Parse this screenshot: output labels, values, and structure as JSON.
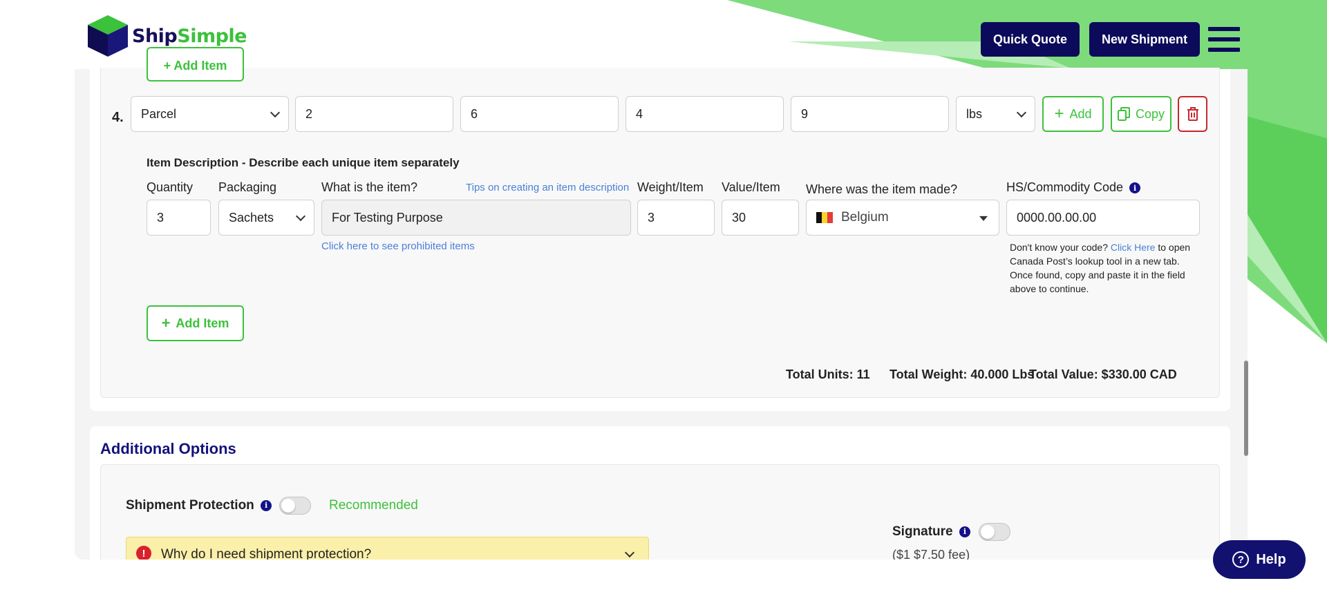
{
  "brand": {
    "name_part1": "Ship",
    "name_part2": "Simple",
    "colors": {
      "navy": "#0c0a5a",
      "green": "#3cc13b",
      "light_green": "#7ddb7c",
      "red": "#c8262d",
      "link": "#4a7fd8"
    }
  },
  "header": {
    "quick_quote": "Quick Quote",
    "new_shipment": "New Shipment",
    "menu_icon": "hamburger-icon"
  },
  "top_partial_button": "+ Add Item",
  "package_row": {
    "number": "4.",
    "type": "Parcel",
    "length": "2",
    "width": "6",
    "height": "4",
    "weight": "9",
    "unit": "lbs",
    "add_label": "Add",
    "copy_label": "Copy",
    "delete_icon": "trash-icon"
  },
  "item_section": {
    "title": "Item Description - Describe each unique item separately",
    "labels": {
      "quantity": "Quantity",
      "packaging": "Packaging",
      "what": "What is the item?",
      "tips": "Tips on creating an item description",
      "weight_item": "Weight/Item",
      "value_item": "Value/Item",
      "made": "Where was the item made?",
      "hs_code": "HS/Commodity Code"
    },
    "values": {
      "quantity": "3",
      "packaging": "Sachets",
      "what": "For Testing Purpose",
      "weight_item": "3",
      "value_item": "30",
      "country": "Belgium",
      "hs_code": "0000.00.00.00"
    },
    "prohibited_link": "Click here to see prohibited items",
    "hs_help": {
      "prefix": "Don't know your code?",
      "link": "Click Here",
      "suffix_1": "to open",
      "line2": "Canada Post’s lookup tool in a new tab.",
      "line3": "Once found, copy and paste it in the field",
      "line4": "above to continue."
    },
    "add_item": "Add Item"
  },
  "totals": {
    "units": "Total Units: 11",
    "weight": "Total Weight: 40.000 Lbs",
    "value": "Total Value: $330.00 CAD"
  },
  "additional_options": {
    "title": "Additional Options",
    "protection_label": "Shipment Protection",
    "recommended": "Recommended",
    "why_label": "Why do I need shipment protection?",
    "signature_label": "Signature",
    "signature_fee": "($1 $7.50 fee)"
  },
  "help_button": "Help"
}
